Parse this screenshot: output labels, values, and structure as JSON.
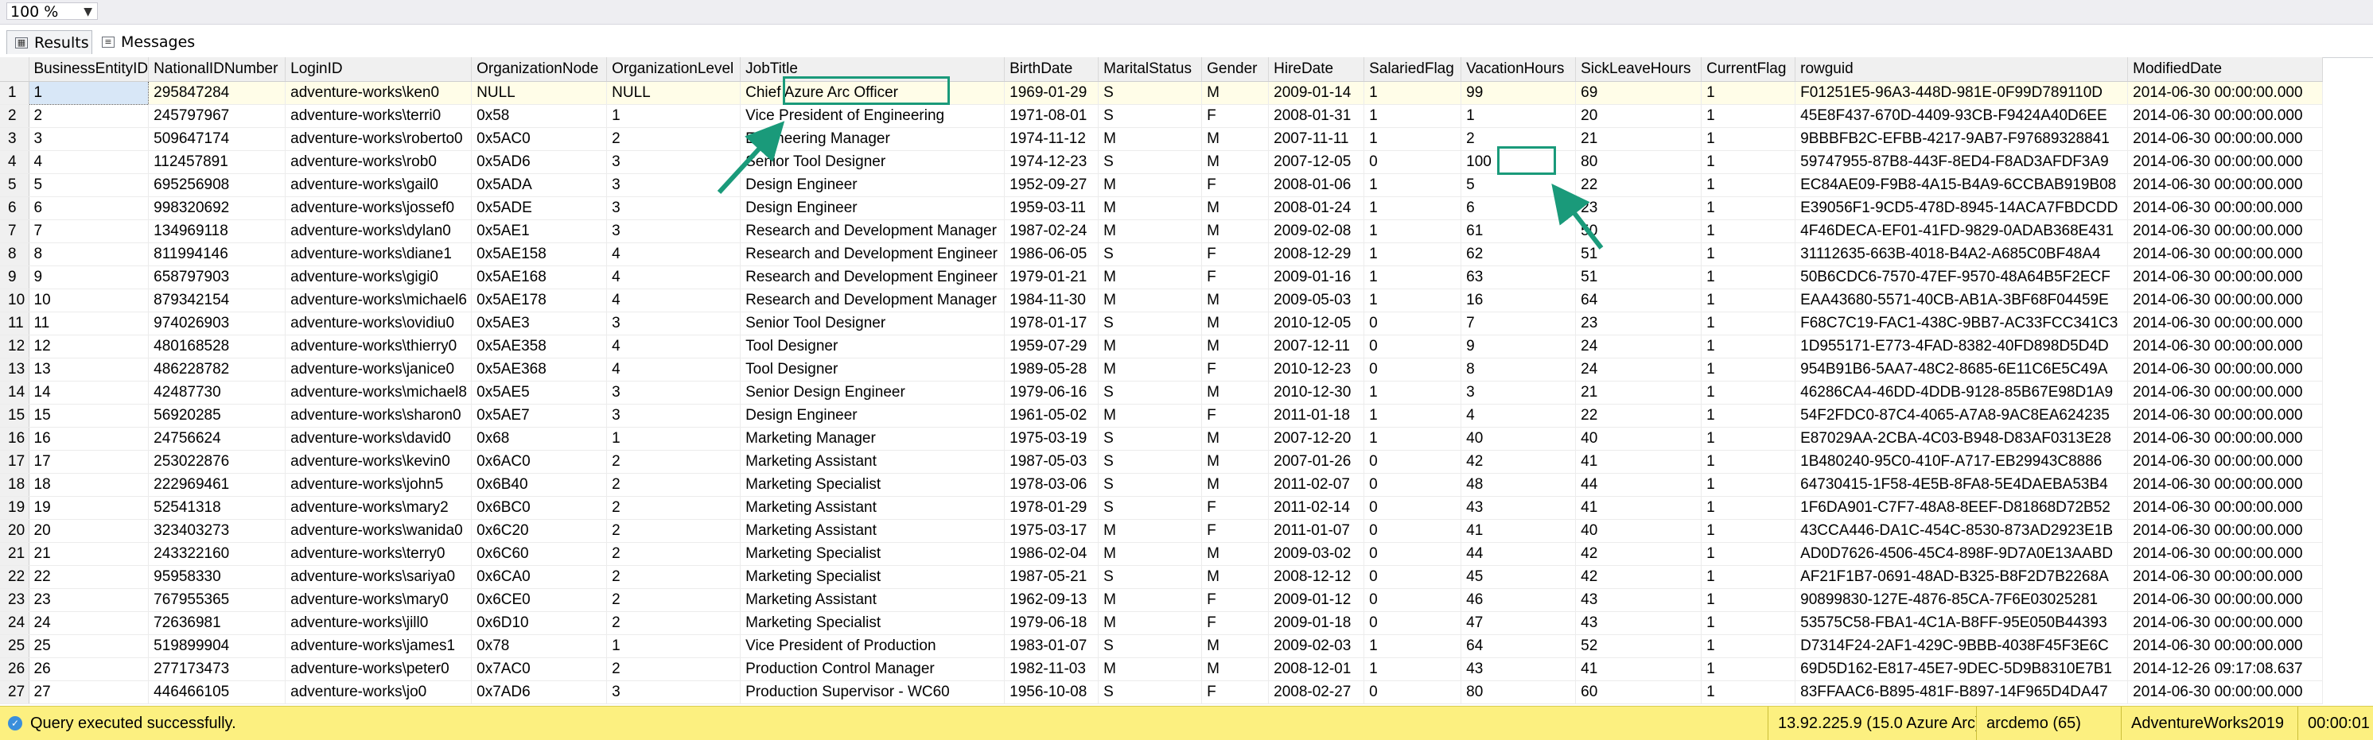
{
  "toolbar": {
    "zoom": "100 %"
  },
  "tabs": [
    {
      "label": "Results"
    },
    {
      "label": "Messages"
    }
  ],
  "grid": {
    "columns": [
      "BusinessEntityID",
      "NationalIDNumber",
      "LoginID",
      "OrganizationNode",
      "OrganizationLevel",
      "JobTitle",
      "BirthDate",
      "MaritalStatus",
      "Gender",
      "HireDate",
      "SalariedFlag",
      "VacationHours",
      "SickLeaveHours",
      "CurrentFlag",
      "rowguid",
      "ModifiedDate"
    ],
    "rows": [
      [
        "1",
        "1",
        "295847284",
        "adventure-works\\ken0",
        "NULL",
        "NULL",
        "Chief Azure Arc Officer",
        "1969-01-29",
        "S",
        "M",
        "2009-01-14",
        "1",
        "99",
        "69",
        "1",
        "F01251E5-96A3-448D-981E-0F99D789110D",
        "2014-06-30 00:00:00.000"
      ],
      [
        "2",
        "2",
        "245797967",
        "adventure-works\\terri0",
        "0x58",
        "1",
        "Vice President of Engineering",
        "1971-08-01",
        "S",
        "F",
        "2008-01-31",
        "1",
        "1",
        "20",
        "1",
        "45E8F437-670D-4409-93CB-F9424A40D6EE",
        "2014-06-30 00:00:00.000"
      ],
      [
        "3",
        "3",
        "509647174",
        "adventure-works\\roberto0",
        "0x5AC0",
        "2",
        "Engineering Manager",
        "1974-11-12",
        "M",
        "M",
        "2007-11-11",
        "1",
        "2",
        "21",
        "1",
        "9BBBFB2C-EFBB-4217-9AB7-F97689328841",
        "2014-06-30 00:00:00.000"
      ],
      [
        "4",
        "4",
        "112457891",
        "adventure-works\\rob0",
        "0x5AD6",
        "3",
        "Senior Tool Designer",
        "1974-12-23",
        "S",
        "M",
        "2007-12-05",
        "0",
        "100",
        "80",
        "1",
        "59747955-87B8-443F-8ED4-F8AD3AFDF3A9",
        "2014-06-30 00:00:00.000"
      ],
      [
        "5",
        "5",
        "695256908",
        "adventure-works\\gail0",
        "0x5ADA",
        "3",
        "Design Engineer",
        "1952-09-27",
        "M",
        "F",
        "2008-01-06",
        "1",
        "5",
        "22",
        "1",
        "EC84AE09-F9B8-4A15-B4A9-6CCBAB919B08",
        "2014-06-30 00:00:00.000"
      ],
      [
        "6",
        "6",
        "998320692",
        "adventure-works\\jossef0",
        "0x5ADE",
        "3",
        "Design Engineer",
        "1959-03-11",
        "M",
        "M",
        "2008-01-24",
        "1",
        "6",
        "23",
        "1",
        "E39056F1-9CD5-478D-8945-14ACA7FBDCDD",
        "2014-06-30 00:00:00.000"
      ],
      [
        "7",
        "7",
        "134969118",
        "adventure-works\\dylan0",
        "0x5AE1",
        "3",
        "Research and Development Manager",
        "1987-02-24",
        "M",
        "M",
        "2009-02-08",
        "1",
        "61",
        "50",
        "1",
        "4F46DECA-EF01-41FD-9829-0ADAB368E431",
        "2014-06-30 00:00:00.000"
      ],
      [
        "8",
        "8",
        "811994146",
        "adventure-works\\diane1",
        "0x5AE158",
        "4",
        "Research and Development Engineer",
        "1986-06-05",
        "S",
        "F",
        "2008-12-29",
        "1",
        "62",
        "51",
        "1",
        "31112635-663B-4018-B4A2-A685C0BF48A4",
        "2014-06-30 00:00:00.000"
      ],
      [
        "9",
        "9",
        "658797903",
        "adventure-works\\gigi0",
        "0x5AE168",
        "4",
        "Research and Development Engineer",
        "1979-01-21",
        "M",
        "F",
        "2009-01-16",
        "1",
        "63",
        "51",
        "1",
        "50B6CDC6-7570-47EF-9570-48A64B5F2ECF",
        "2014-06-30 00:00:00.000"
      ],
      [
        "10",
        "10",
        "879342154",
        "adventure-works\\michael6",
        "0x5AE178",
        "4",
        "Research and Development Manager",
        "1984-11-30",
        "M",
        "M",
        "2009-05-03",
        "1",
        "16",
        "64",
        "1",
        "EAA43680-5571-40CB-AB1A-3BF68F04459E",
        "2014-06-30 00:00:00.000"
      ],
      [
        "11",
        "11",
        "974026903",
        "adventure-works\\ovidiu0",
        "0x5AE3",
        "3",
        "Senior Tool Designer",
        "1978-01-17",
        "S",
        "M",
        "2010-12-05",
        "0",
        "7",
        "23",
        "1",
        "F68C7C19-FAC1-438C-9BB7-AC33FCC341C3",
        "2014-06-30 00:00:00.000"
      ],
      [
        "12",
        "12",
        "480168528",
        "adventure-works\\thierry0",
        "0x5AE358",
        "4",
        "Tool Designer",
        "1959-07-29",
        "M",
        "M",
        "2007-12-11",
        "0",
        "9",
        "24",
        "1",
        "1D955171-E773-4FAD-8382-40FD898D5D4D",
        "2014-06-30 00:00:00.000"
      ],
      [
        "13",
        "13",
        "486228782",
        "adventure-works\\janice0",
        "0x5AE368",
        "4",
        "Tool Designer",
        "1989-05-28",
        "M",
        "F",
        "2010-12-23",
        "0",
        "8",
        "24",
        "1",
        "954B91B6-5AA7-48C2-8685-6E11C6E5C49A",
        "2014-06-30 00:00:00.000"
      ],
      [
        "14",
        "14",
        "42487730",
        "adventure-works\\michael8",
        "0x5AE5",
        "3",
        "Senior Design Engineer",
        "1979-06-16",
        "S",
        "M",
        "2010-12-30",
        "1",
        "3",
        "21",
        "1",
        "46286CA4-46DD-4DDB-9128-85B67E98D1A9",
        "2014-06-30 00:00:00.000"
      ],
      [
        "15",
        "15",
        "56920285",
        "adventure-works\\sharon0",
        "0x5AE7",
        "3",
        "Design Engineer",
        "1961-05-02",
        "M",
        "F",
        "2011-01-18",
        "1",
        "4",
        "22",
        "1",
        "54F2FDC0-87C4-4065-A7A8-9AC8EA624235",
        "2014-06-30 00:00:00.000"
      ],
      [
        "16",
        "16",
        "24756624",
        "adventure-works\\david0",
        "0x68",
        "1",
        "Marketing Manager",
        "1975-03-19",
        "S",
        "M",
        "2007-12-20",
        "1",
        "40",
        "40",
        "1",
        "E87029AA-2CBA-4C03-B948-D83AF0313E28",
        "2014-06-30 00:00:00.000"
      ],
      [
        "17",
        "17",
        "253022876",
        "adventure-works\\kevin0",
        "0x6AC0",
        "2",
        "Marketing Assistant",
        "1987-05-03",
        "S",
        "M",
        "2007-01-26",
        "0",
        "42",
        "41",
        "1",
        "1B480240-95C0-410F-A717-EB29943C8886",
        "2014-06-30 00:00:00.000"
      ],
      [
        "18",
        "18",
        "222969461",
        "adventure-works\\john5",
        "0x6B40",
        "2",
        "Marketing Specialist",
        "1978-03-06",
        "S",
        "M",
        "2011-02-07",
        "0",
        "48",
        "44",
        "1",
        "64730415-1F58-4E5B-8FA8-5E4DAEBA53B4",
        "2014-06-30 00:00:00.000"
      ],
      [
        "19",
        "19",
        "52541318",
        "adventure-works\\mary2",
        "0x6BC0",
        "2",
        "Marketing Assistant",
        "1978-01-29",
        "S",
        "F",
        "2011-02-14",
        "0",
        "43",
        "41",
        "1",
        "1F6DA901-C7F7-48A8-8EEF-D81868D72B52",
        "2014-06-30 00:00:00.000"
      ],
      [
        "20",
        "20",
        "323403273",
        "adventure-works\\wanida0",
        "0x6C20",
        "2",
        "Marketing Assistant",
        "1975-03-17",
        "M",
        "F",
        "2011-01-07",
        "0",
        "41",
        "40",
        "1",
        "43CCA446-DA1C-454C-8530-873AD2923E1B",
        "2014-06-30 00:00:00.000"
      ],
      [
        "21",
        "21",
        "243322160",
        "adventure-works\\terry0",
        "0x6C60",
        "2",
        "Marketing Specialist",
        "1986-02-04",
        "M",
        "M",
        "2009-03-02",
        "0",
        "44",
        "42",
        "1",
        "AD0D7626-4506-45C4-898F-9D7A0E13AABD",
        "2014-06-30 00:00:00.000"
      ],
      [
        "22",
        "22",
        "95958330",
        "adventure-works\\sariya0",
        "0x6CA0",
        "2",
        "Marketing Specialist",
        "1987-05-21",
        "S",
        "M",
        "2008-12-12",
        "0",
        "45",
        "42",
        "1",
        "AF21F1B7-0691-48AD-B325-B8F2D7B2268A",
        "2014-06-30 00:00:00.000"
      ],
      [
        "23",
        "23",
        "767955365",
        "adventure-works\\mary0",
        "0x6CE0",
        "2",
        "Marketing Assistant",
        "1962-09-13",
        "M",
        "F",
        "2009-01-12",
        "0",
        "46",
        "43",
        "1",
        "90899830-127E-4876-85CA-7F6E03025281",
        "2014-06-30 00:00:00.000"
      ],
      [
        "24",
        "24",
        "72636981",
        "adventure-works\\jill0",
        "0x6D10",
        "2",
        "Marketing Specialist",
        "1979-06-18",
        "M",
        "F",
        "2009-01-18",
        "0",
        "47",
        "43",
        "1",
        "53575C58-FBA1-4C1A-B8FF-95E050B44393",
        "2014-06-30 00:00:00.000"
      ],
      [
        "25",
        "25",
        "519899904",
        "adventure-works\\james1",
        "0x78",
        "1",
        "Vice President of Production",
        "1983-01-07",
        "S",
        "M",
        "2009-02-03",
        "1",
        "64",
        "52",
        "1",
        "D7314F24-2AF1-429C-9BBB-4038F45F3E6C",
        "2014-06-30 00:00:00.000"
      ],
      [
        "26",
        "26",
        "277173473",
        "adventure-works\\peter0",
        "0x7AC0",
        "2",
        "Production Control Manager",
        "1982-11-03",
        "M",
        "M",
        "2008-12-01",
        "1",
        "43",
        "41",
        "1",
        "69D5D162-E817-45E7-9DEC-5D9B8310E7B1",
        "2014-12-26 09:17:08.637"
      ],
      [
        "27",
        "27",
        "446466105",
        "adventure-works\\jo0",
        "0x7AD6",
        "3",
        "Production Supervisor - WC60",
        "1956-10-08",
        "S",
        "F",
        "2008-02-27",
        "0",
        "80",
        "60",
        "1",
        "83FFAAC6-B895-481F-B897-14F965D4DA47",
        "2014-06-30 00:00:00.000"
      ]
    ]
  },
  "status": {
    "message": "Query executed successfully.",
    "server": "13.92.225.9 (15.0 Azure Arc)",
    "user": "arcdemo (65)",
    "database": "AdventureWorks2019",
    "elapsed": "00:00:01"
  },
  "colors": {
    "highlight": "#1a9a7a",
    "status_bar": "#fcf080"
  },
  "icons": {
    "results_tab": "grid-icon",
    "messages_tab": "messages-icon",
    "status": "check-circle-icon"
  }
}
